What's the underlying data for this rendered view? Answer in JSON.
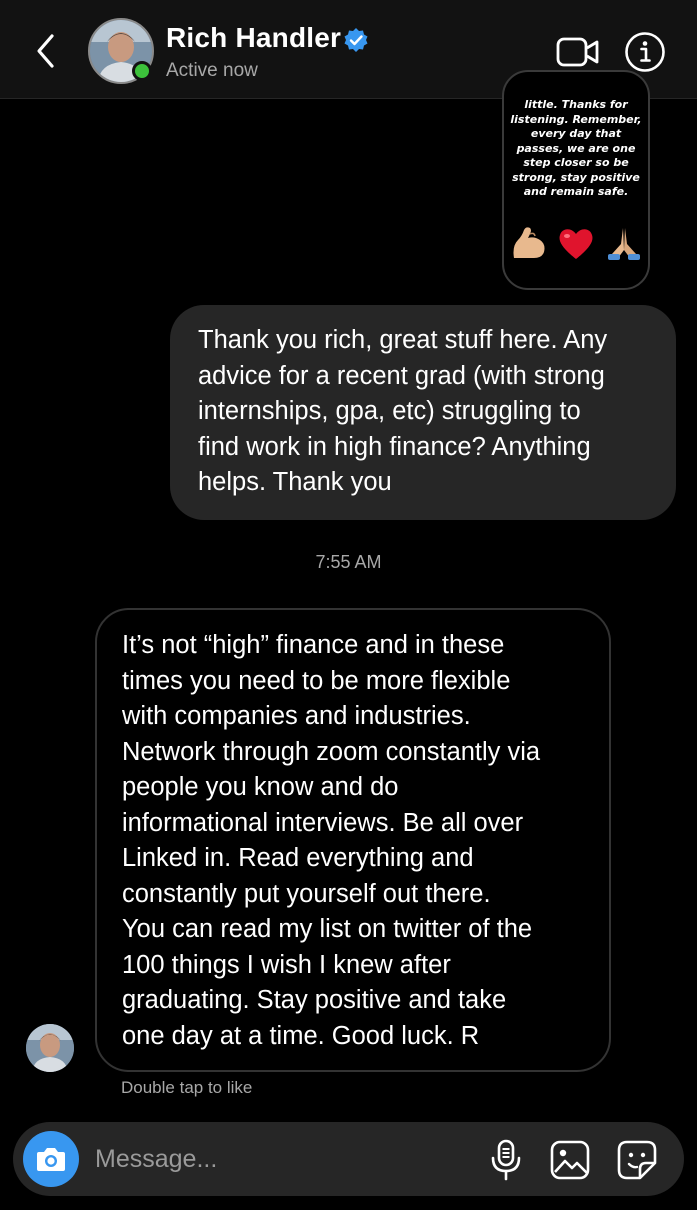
{
  "header": {
    "contact_name": "Rich Handler",
    "status": "Active now",
    "icons": {
      "back": "chevron-left-icon",
      "verified": "verified-badge-icon",
      "video": "video-camera-icon",
      "info": "info-icon"
    },
    "colors": {
      "verified": "#3897f0",
      "active": "#3cc13b"
    }
  },
  "thread": {
    "story_reply": {
      "text": "little. Thanks for\nlistening. Remember,\nevery day that\npasses, we are one\nstep closer so be\nstrong, stay positive\nand remain safe.",
      "emojis": [
        "flexed-biceps",
        "red-heart",
        "folded-hands"
      ]
    },
    "sent_message": {
      "lines": [
        "Thank you rich, great stuff here. Any",
        "advice for a recent grad (with strong",
        "internships, gpa, etc) struggling to",
        "find work in high finance? Anything",
        "helps. Thank you"
      ]
    },
    "timestamp": "7:55 AM",
    "received_message": {
      "lines": [
        "It’s not “high” finance and in these",
        "times you need to be more flexible",
        "with companies and industries.",
        "Network through zoom constantly via",
        "people you know and do",
        "informational interviews. Be all over",
        "Linked in.  Read everything and",
        "constantly put yourself out there.",
        "You can read my list on twitter of the",
        "100 things I wish I knew after",
        "graduating. Stay positive and take",
        "one day at a time. Good luck. R"
      ]
    },
    "like_hint": "Double tap to like"
  },
  "composer": {
    "placeholder": "Message...",
    "icons": {
      "camera": "camera-icon",
      "mic": "microphone-icon",
      "gallery": "gallery-icon",
      "sticker": "sticker-icon"
    },
    "colors": {
      "camera_bg": "#3897f0"
    }
  }
}
